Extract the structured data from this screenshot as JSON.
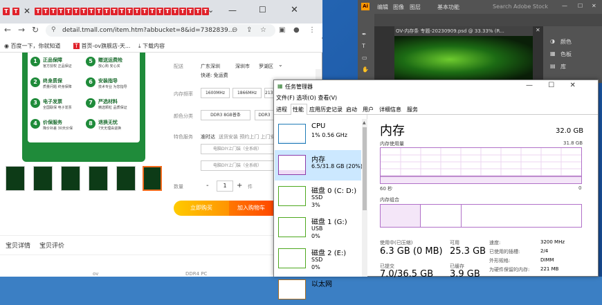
{
  "browser": {
    "tab_title": "TTTTTTTTTTTTTTTTTTTTTTTTT",
    "url": "detail.tmall.com/item.htm?abbucket=8&id=7382839...",
    "bookmarks": [
      "百度一下，你就知道",
      "首页-ov旗舰店-天...",
      "下载内容"
    ],
    "features": [
      {
        "num": "1",
        "title": "正品保障",
        "sub": "官方授权 正品保证"
      },
      {
        "num": "5",
        "title": "赠送运费险",
        "sub": "放心购 安心买"
      },
      {
        "num": "2",
        "title": "终身质保",
        "sub": "质量问题 终身保障"
      },
      {
        "num": "6",
        "title": "安装指导",
        "sub": "技术专业 为您指导"
      },
      {
        "num": "3",
        "title": "电子发票",
        "sub": "全国联保 电子发票"
      },
      {
        "num": "7",
        "title": "严选材料",
        "sub": "精选颗粒 品质保证"
      },
      {
        "num": "4",
        "title": "价保服务",
        "sub": "降价补差 30天价保"
      },
      {
        "num": "8",
        "title": "退换无忧",
        "sub": "7天无理由退换"
      }
    ],
    "shipping_label": "配送",
    "shipping_from": "广东深圳",
    "shipping_to_1": "深圳市",
    "shipping_to_2": "罗湖区",
    "shipping_fee": "快递: 免运费",
    "freq_label": "内存频率",
    "freq_options": [
      "1600MHz",
      "1866MHz",
      "2133MHz"
    ],
    "color_label": "颜色分类",
    "color_options": [
      "DDR3 8GB普条",
      "DDR3"
    ],
    "service_label": "特色服务",
    "service_1": "准时达",
    "service_2": "送货安装 预约上门 上门安装",
    "service_3": "电脑DIY上门装（全系统）",
    "service_4": "电脑DIY上门装（全系统）",
    "qty_label": "数量",
    "qty_minus": "-",
    "qty": "1",
    "qty_plus": "+",
    "qty_unit": "件",
    "buy_now": "立即购买",
    "add_cart": "加入购物车",
    "detail_tab": "宝贝详情",
    "review_tab": "宝贝评价",
    "bottom_1": "ov",
    "bottom_2": "DDR4 PC"
  },
  "photoshop": {
    "menu_ai": "Ai",
    "menu_items": [
      "编辑",
      "图像",
      "图层"
    ],
    "workspace": "基本功能",
    "search": "Search Adobe Stock",
    "doc_tab": "OV-内存条 专题-20230909.psd @ 33.33% (R...",
    "panel_items": [
      "颜色",
      "色板",
      "库"
    ]
  },
  "taskmgr": {
    "title": "任务管理器",
    "menu": "文件(F)  选项(O)  查看(V)",
    "tabs": [
      "进程",
      "性能",
      "应用历史记录",
      "启动",
      "用户",
      "详细信息",
      "服务"
    ],
    "resources": [
      {
        "name": "CPU",
        "sub1": "1% 0.56 GHz",
        "sub2": "",
        "color": "#1e7ab6"
      },
      {
        "name": "内存",
        "sub1": "6.5/31.8 GB (20%)",
        "sub2": "",
        "color": "#8b3aa8"
      },
      {
        "name": "磁盘 0 (C: D:)",
        "sub1": "SSD",
        "sub2": "3%",
        "color": "#4da81e"
      },
      {
        "name": "磁盘 1 (G:)",
        "sub1": "USB",
        "sub2": "0%",
        "color": "#4da81e"
      },
      {
        "name": "磁盘 2 (E:)",
        "sub1": "SSD",
        "sub2": "0%",
        "color": "#4da81e"
      },
      {
        "name": "以太网",
        "sub1": "",
        "sub2": "",
        "color": "#a86b1e"
      }
    ],
    "memory": {
      "title": "内存",
      "total": "32.0 GB",
      "usage_label": "内存使用量",
      "usage_max": "31.8 GB",
      "time_label": "60 秒",
      "time_end": "0",
      "comp_label": "内存组合",
      "in_use_label": "使用中(已压缩)",
      "in_use": "6.3 GB (0 MB)",
      "available_label": "可用",
      "available": "25.3 GB",
      "committed_label": "已提交",
      "committed": "7.0/36.5 GB",
      "cached_label": "已缓存",
      "cached": "3.9 GB",
      "speed_label": "速度:",
      "speed": "3200 MHz",
      "slots_label": "已使用的插槽:",
      "slots": "2/4",
      "form_label": "外形规格:",
      "form": "DIMM",
      "reserved_label": "为硬件保留的内存:",
      "reserved": "221 MB"
    }
  }
}
